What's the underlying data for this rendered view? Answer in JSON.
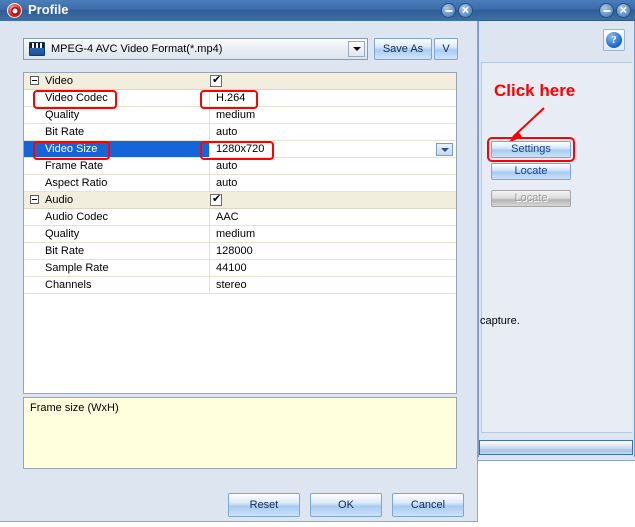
{
  "background_window": {
    "title": "",
    "help_icon": "question-mark-icon",
    "minimize_label": "−",
    "close_label": "✕",
    "body_text": "capture.",
    "annotation": "Click here",
    "buttons": [
      {
        "label": "Settings",
        "state": "enabled",
        "highlighted": true
      },
      {
        "label": "Locate",
        "state": "enabled",
        "highlighted": false
      },
      {
        "label": "Locate",
        "state": "disabled",
        "highlighted": false
      }
    ]
  },
  "dialog": {
    "title": "Profile",
    "icon": "profile-target-icon",
    "minimize_label": "−",
    "close_label": "✕",
    "format": {
      "value": "MPEG-4 AVC Video Format(*.mp4)",
      "icon": "film-clapper-icon",
      "dropdown_icon": "chevron-down-icon"
    },
    "save_as_label": "Save As",
    "v_label": "V",
    "grid": {
      "groups": [
        {
          "name": "Video",
          "checked": true,
          "rows": [
            {
              "name": "Video Codec",
              "value": "H.264",
              "selected": false,
              "highlighted": true,
              "dropdown": false
            },
            {
              "name": "Quality",
              "value": "medium",
              "selected": false,
              "highlighted": false,
              "dropdown": false
            },
            {
              "name": "Bit Rate",
              "value": "auto",
              "selected": false,
              "highlighted": false,
              "dropdown": false
            },
            {
              "name": "Video Size",
              "value": "1280x720",
              "selected": true,
              "highlighted": true,
              "dropdown": true
            },
            {
              "name": "Frame Rate",
              "value": "auto",
              "selected": false,
              "highlighted": false,
              "dropdown": false
            },
            {
              "name": "Aspect Ratio",
              "value": "auto",
              "selected": false,
              "highlighted": false,
              "dropdown": false
            }
          ]
        },
        {
          "name": "Audio",
          "checked": true,
          "rows": [
            {
              "name": "Audio Codec",
              "value": "AAC",
              "selected": false,
              "highlighted": false,
              "dropdown": false
            },
            {
              "name": "Quality",
              "value": "medium",
              "selected": false,
              "highlighted": false,
              "dropdown": false
            },
            {
              "name": "Bit Rate",
              "value": "128000",
              "selected": false,
              "highlighted": false,
              "dropdown": false
            },
            {
              "name": "Sample Rate",
              "value": "44100",
              "selected": false,
              "highlighted": false,
              "dropdown": false
            },
            {
              "name": "Channels",
              "value": "stereo",
              "selected": false,
              "highlighted": false,
              "dropdown": false
            }
          ]
        }
      ]
    },
    "hint": "Frame size (WxH)",
    "footer": {
      "reset_label": "Reset",
      "ok_label": "OK",
      "cancel_label": "Cancel"
    }
  },
  "colors": {
    "titlebar_blue": "#3d6ba8",
    "selection_blue": "#1565d8",
    "highlight_red": "#ff0000",
    "group_row_bg": "#f2eedd",
    "hint_bg": "#ffffdd",
    "dialog_bg": "#dde5f0"
  }
}
